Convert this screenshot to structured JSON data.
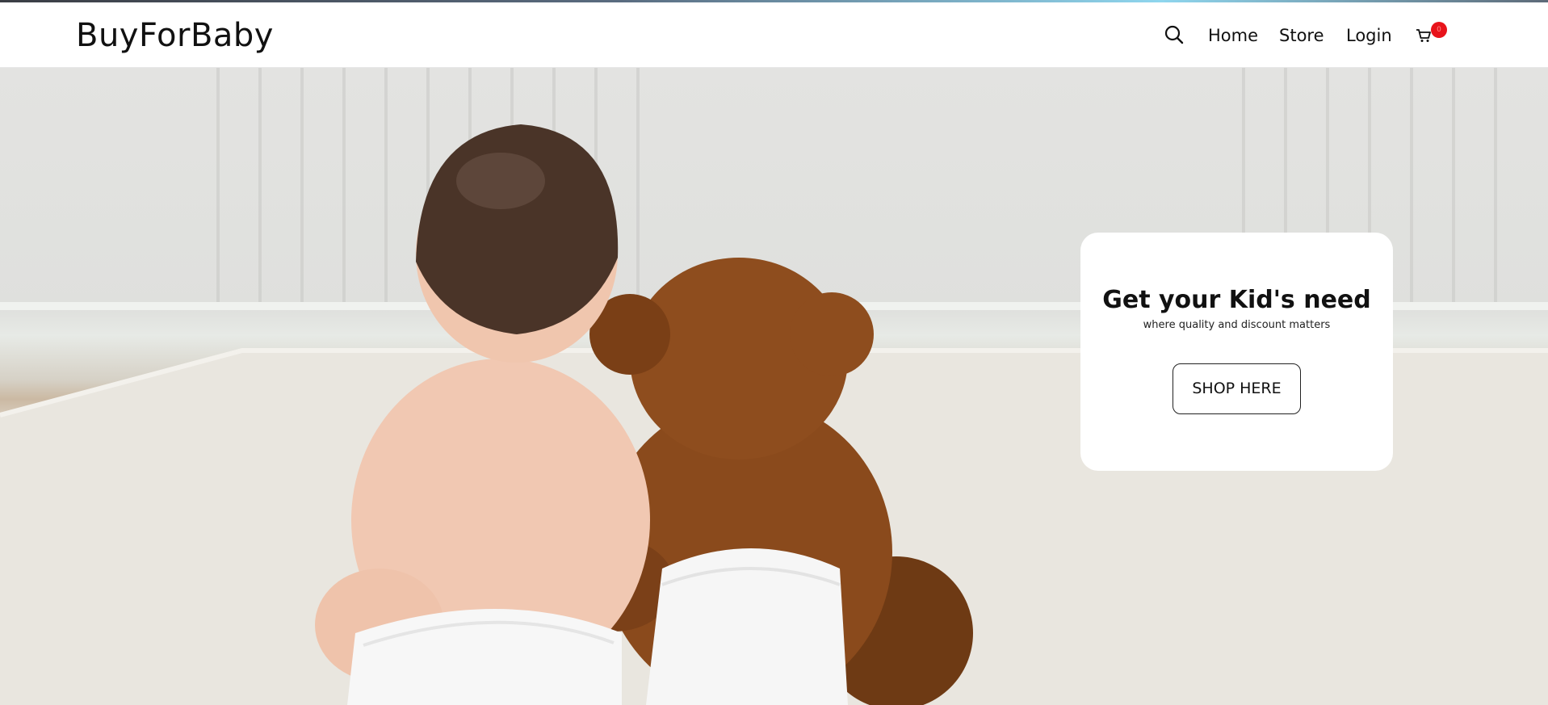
{
  "header": {
    "brand": "BuyForBaby",
    "search_icon": "search-icon",
    "nav": {
      "home": "Home",
      "store": "Store",
      "login": "Login"
    },
    "cart_icon": "cart-icon",
    "cart_count": "0"
  },
  "hero": {
    "image": "baby-with-teddy-bear-photo",
    "title": "Get your Kid's need",
    "subtitle": "where quality and discount matters",
    "cta_label": "SHOP HERE"
  },
  "colors": {
    "badge": "#e8141b",
    "text": "#111111",
    "card_bg": "#ffffff"
  }
}
